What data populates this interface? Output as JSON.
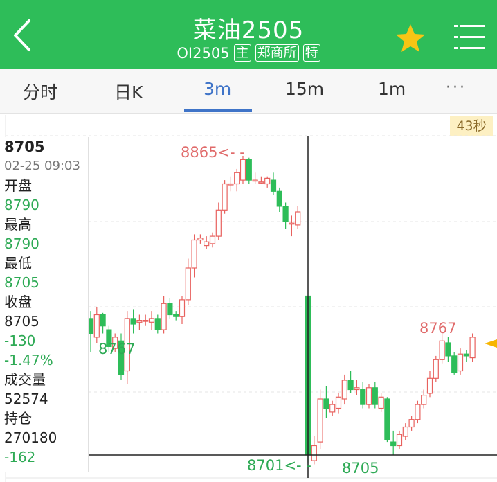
{
  "header": {
    "title": "菜油2505",
    "code": "OI2505",
    "tags": [
      "主",
      "郑商所",
      "特"
    ],
    "icons": {
      "back": "back-arrow-icon",
      "favorite": "star-icon",
      "menu": "menu-icon"
    },
    "colors": {
      "bar": "#2ebd59",
      "star": "#f7c515"
    }
  },
  "tabs": [
    {
      "label": "分时",
      "active": false
    },
    {
      "label": "日K",
      "active": false
    },
    {
      "label": "3m",
      "active": true
    },
    {
      "label": "15m",
      "active": false
    },
    {
      "label": "1m",
      "active": false
    },
    {
      "label": "···",
      "active": false
    }
  ],
  "timer": "43秒",
  "info_panel": {
    "price": "8705",
    "datetime": "02-25 09:03",
    "open_label": "开盘",
    "open_value": "8790",
    "high_label": "最高",
    "high_value": "8790",
    "low_label": "最低",
    "low_value": "8705",
    "close_label": "收盘",
    "close_value": "8705",
    "change": "-130",
    "change_pct": "-1.47%",
    "volume_label": "成交量",
    "volume_value": "52574",
    "oi_label": "持仓",
    "oi_value": "270180",
    "oi_change": "-162"
  },
  "chart_labels": {
    "high_marker": "8865<- -",
    "low_left": "8767",
    "low_marker": "8701<- -",
    "low_right": "8705",
    "high_right": "8767"
  },
  "chart_data": {
    "type": "candlestick",
    "colors": {
      "up": "#e8615e",
      "down": "#2ebd59"
    },
    "segment_1_open_high_low_close": [
      [
        8778,
        8782,
        8760,
        8770
      ],
      [
        8768,
        8784,
        8765,
        8780
      ],
      [
        8780,
        8781,
        8770,
        8774
      ],
      [
        8772,
        8774,
        8760,
        8763
      ],
      [
        8762,
        8770,
        8760,
        8768
      ],
      [
        8766,
        8770,
        8745,
        8748
      ],
      [
        8750,
        8782,
        8743,
        8778
      ],
      [
        8778,
        8783,
        8770,
        8775
      ],
      [
        8776,
        8780,
        8772,
        8777
      ],
      [
        8777,
        8780,
        8774,
        8777
      ],
      [
        8776,
        8782,
        8772,
        8778
      ],
      [
        8778,
        8780,
        8770,
        8772
      ],
      [
        8772,
        8790,
        8770,
        8786
      ],
      [
        8786,
        8789,
        8778,
        8780
      ],
      [
        8780,
        8782,
        8777,
        8779
      ],
      [
        8779,
        8790,
        8775,
        8788
      ],
      [
        8788,
        8810,
        8785,
        8805
      ],
      [
        8805,
        8823,
        8800,
        8820
      ],
      [
        8820,
        8823,
        8818,
        8821
      ],
      [
        8817,
        8822,
        8815,
        8819
      ],
      [
        8818,
        8824,
        8816,
        8822
      ],
      [
        8822,
        8840,
        8820,
        8836
      ],
      [
        8836,
        8852,
        8834,
        8850
      ],
      [
        8850,
        8854,
        8846,
        8850
      ],
      [
        8850,
        8858,
        8846,
        8856
      ],
      [
        8852,
        8865,
        8850,
        8863
      ],
      [
        8863,
        8864,
        8850,
        8852
      ],
      [
        8852,
        8856,
        8850,
        8852
      ],
      [
        8851,
        8854,
        8850,
        8851
      ],
      [
        8850,
        8854,
        8848,
        8853
      ],
      [
        8852,
        8856,
        8844,
        8846
      ],
      [
        8846,
        8848,
        8835,
        8838
      ],
      [
        8838,
        8840,
        8826,
        8830
      ],
      [
        8829,
        8833,
        8822,
        8829
      ],
      [
        8828,
        8838,
        8826,
        8835
      ]
    ],
    "segment_2_open_high_low_close": [
      [
        8790,
        8790,
        8701,
        8705
      ],
      [
        8702,
        8715,
        8700,
        8710
      ],
      [
        8712,
        8740,
        8708,
        8735
      ],
      [
        8735,
        8742,
        8725,
        8730
      ],
      [
        8728,
        8734,
        8726,
        8732
      ],
      [
        8730,
        8738,
        8727,
        8736
      ],
      [
        8735,
        8748,
        8732,
        8745
      ],
      [
        8745,
        8750,
        8738,
        8740
      ],
      [
        8740,
        8745,
        8737,
        8741
      ],
      [
        8740,
        8744,
        8730,
        8732
      ],
      [
        8732,
        8743,
        8730,
        8741
      ],
      [
        8741,
        8744,
        8730,
        8732
      ],
      [
        8730,
        8738,
        8728,
        8736
      ],
      [
        8735,
        8736,
        8712,
        8713
      ],
      [
        8712,
        8718,
        8705,
        8710
      ],
      [
        8710,
        8718,
        8708,
        8716
      ],
      [
        8715,
        8722,
        8713,
        8720
      ],
      [
        8720,
        8726,
        8718,
        8724
      ],
      [
        8724,
        8734,
        8722,
        8732
      ],
      [
        8732,
        8740,
        8730,
        8737
      ],
      [
        8738,
        8750,
        8736,
        8746
      ],
      [
        8746,
        8758,
        8744,
        8756
      ],
      [
        8756,
        8770,
        8754,
        8766
      ],
      [
        8765,
        8768,
        8755,
        8758
      ],
      [
        8758,
        8760,
        8748,
        8749
      ],
      [
        8750,
        8762,
        8748,
        8759
      ],
      [
        8759,
        8761,
        8755,
        8758
      ],
      [
        8757,
        8770,
        8755,
        8768
      ]
    ],
    "crosshair_price": "8705",
    "current_price_marker": "8767"
  }
}
